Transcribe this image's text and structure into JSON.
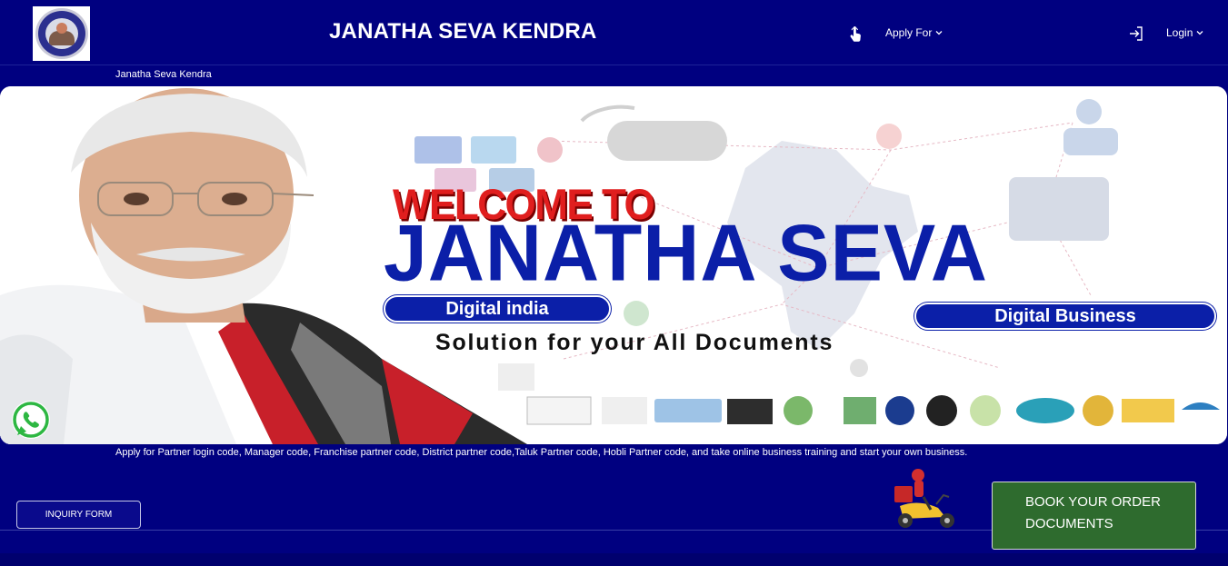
{
  "header": {
    "site_title": "JANATHA SEVA KENDRA",
    "nav": {
      "apply_label": "Apply For",
      "login_label": "Login"
    }
  },
  "breadcrumb": "Janatha Seva Kendra",
  "banner": {
    "welcome": "WELCOME TO",
    "headline": "JANATHA SEVA",
    "tag_left": "Digital india",
    "tag_right": "Digital Business",
    "tagline": "Solution for your All Documents",
    "prev_symbol": "‹",
    "next_symbol": "›"
  },
  "description": "Apply for Partner login code, Manager code, Franchise partner code, District partner code,Taluk Partner code, Hobli Partner code, and take online business training and start your own business.",
  "actions": {
    "inquiry_label": "INQUIRY FORM",
    "book_label": "BOOK YOUR ORDER DOCUMENTS"
  },
  "icons": {
    "apply": "hand-pointer-icon",
    "login": "sign-in-icon",
    "whatsapp": "whatsapp-icon",
    "chevron": "chevron-down-icon"
  },
  "colors": {
    "background": "#000080",
    "book_button": "#2e6b2e",
    "headline_blue": "#0b1fa8",
    "welcome_red": "#e01e1e"
  }
}
